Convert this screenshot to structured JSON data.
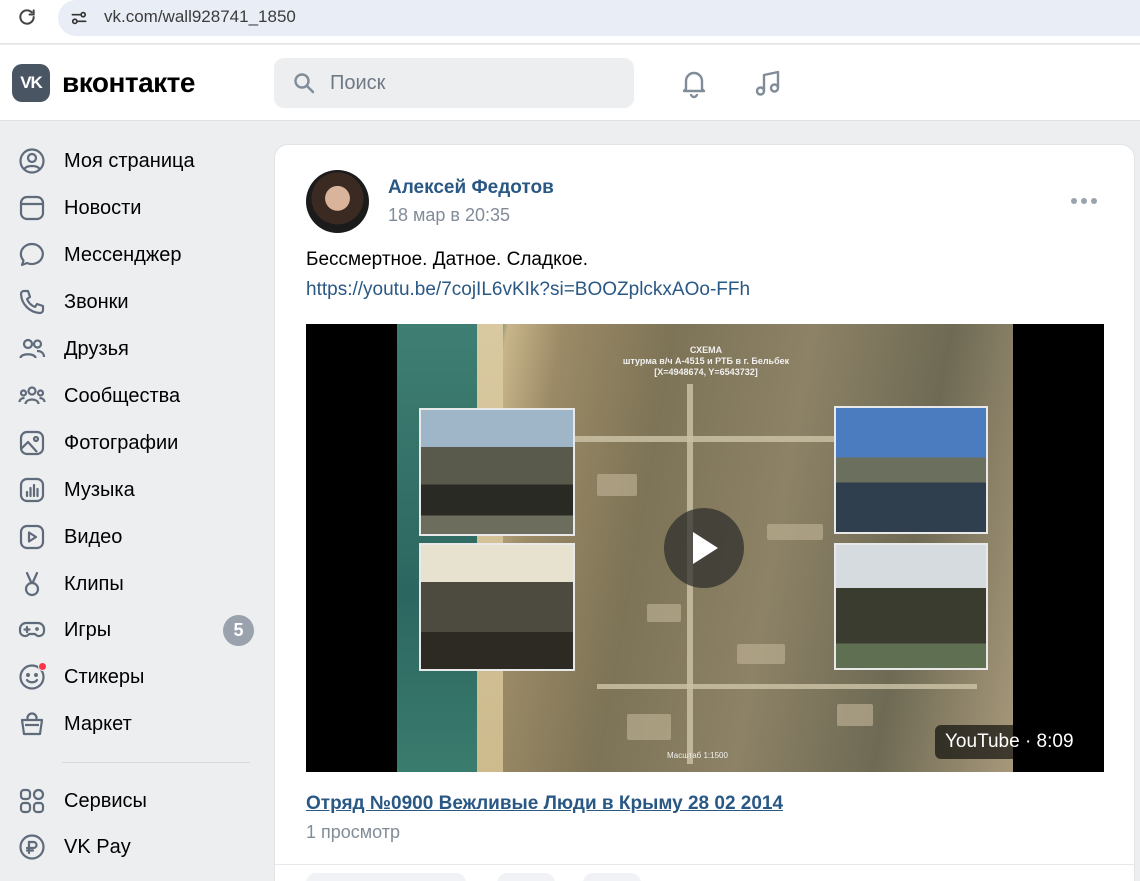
{
  "browser": {
    "url": "vk.com/wall928741_1850",
    "icons": {
      "reload": "reload-icon",
      "site_info": "site-info-icon"
    }
  },
  "header": {
    "logo_mark": "VK",
    "logo_text": "вконтакте",
    "search_placeholder": "Поиск",
    "icons": [
      "bell-icon",
      "music-note-icon"
    ]
  },
  "sidebar": {
    "items": [
      {
        "label": "Моя страница",
        "icon": "user-circle-icon"
      },
      {
        "label": "Новости",
        "icon": "news-icon"
      },
      {
        "label": "Мессенджер",
        "icon": "message-icon"
      },
      {
        "label": "Звонки",
        "icon": "phone-icon"
      },
      {
        "label": "Друзья",
        "icon": "friends-icon"
      },
      {
        "label": "Сообщества",
        "icon": "communities-icon"
      },
      {
        "label": "Фотографии",
        "icon": "photo-icon"
      },
      {
        "label": "Музыка",
        "icon": "music-icon"
      },
      {
        "label": "Видео",
        "icon": "video-icon"
      },
      {
        "label": "Клипы",
        "icon": "clips-icon"
      },
      {
        "label": "Игры",
        "icon": "games-icon",
        "badge": "5"
      },
      {
        "label": "Стикеры",
        "icon": "stickers-icon",
        "notification_dot": true
      },
      {
        "label": "Маркет",
        "icon": "market-icon"
      },
      {
        "label": "Сервисы",
        "icon": "services-icon"
      },
      {
        "label": "VK Pay",
        "icon": "vk-pay-icon"
      }
    ]
  },
  "post": {
    "author": "Алексей Федотов",
    "date": "18 мар в 20:35",
    "text": "Бессмертное. Датное. Сладкое.",
    "link": "https://youtu.be/7cojIL6vKIk?si=BOOZplckxAOo-FFh",
    "video": {
      "source_duration": "YouTube · 8:09",
      "title": "Отряд №0900 Вежливые Люди в Крыму 28 02 2014",
      "views": "1 просмотр",
      "thumbnail_text": {
        "line1": "СХЕМА",
        "line2": "штурма в/ч А-4515 и РТБ в г. Бельбек",
        "line3": "[X=4948674, Y=6543732]",
        "scale": "Масштаб 1:1500"
      }
    }
  },
  "colors": {
    "link": "#2a5885",
    "secondary_text": "#818c99",
    "page_bg": "#edeef0",
    "badge_bg": "#99a2ad",
    "notification_dot": "#ff3347",
    "icon": "#5f6b7a"
  }
}
